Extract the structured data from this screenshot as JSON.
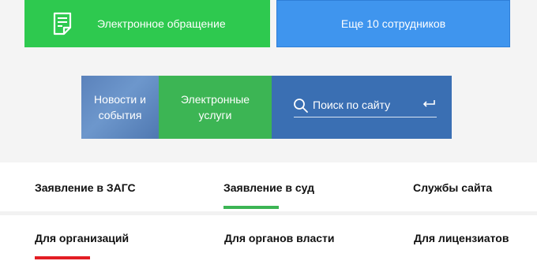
{
  "buttons": {
    "electronic_appeal": "Электронное обращение",
    "more_employees": "Еще 10 сотрудников"
  },
  "tiles": {
    "news_line1": "Новости и",
    "news_line2": "события",
    "services_line1": "Электронные",
    "services_line2": "услуги"
  },
  "search": {
    "placeholder": "Поиск по сайту"
  },
  "tabs_row1": [
    {
      "label": "Заявление в ЗАГС",
      "active": false
    },
    {
      "label": "Заявление в суд",
      "active": true
    },
    {
      "label": "Службы сайта",
      "active": false
    }
  ],
  "tabs_row2": [
    {
      "label": "Для организаций",
      "active": true
    },
    {
      "label": "Для органов власти",
      "active": false
    },
    {
      "label": "Для лицензиатов",
      "active": false
    }
  ],
  "colors": {
    "green_button": "#2ec94f",
    "blue_button": "#3f95ee",
    "news_tile": "#5b82bb",
    "services_tile": "#3cb554",
    "search_tile": "#3a6fb3",
    "active_tab_green": "#3cb554",
    "active_tab_red": "#e31e24"
  },
  "icons": {
    "appeal": "document-pen-icon",
    "search": "search-icon",
    "enter": "enter-return-icon"
  }
}
